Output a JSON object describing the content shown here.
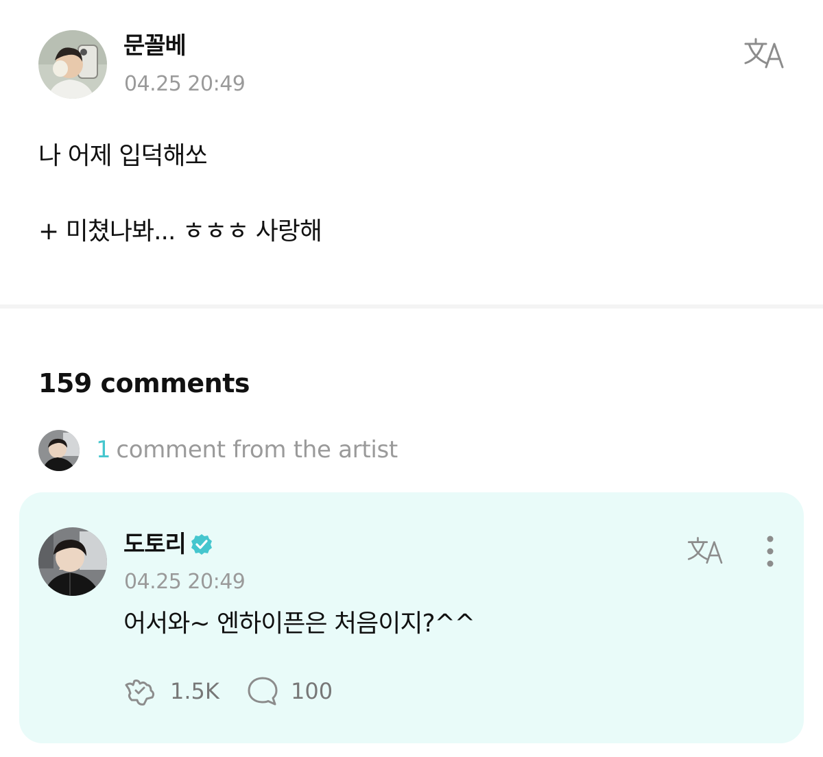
{
  "post": {
    "author": "문꼴베",
    "time": "04.25 20:49",
    "lines": [
      "나 어제 입덕해쏘",
      "+ 미쳤나봐... ㅎㅎㅎ 사랑해"
    ],
    "translate_icon": "translate-icon"
  },
  "comments": {
    "count_label": "159 comments",
    "artist_count": "1",
    "artist_label": "comment from the artist"
  },
  "artist_comment": {
    "author": "도토리",
    "verified_icon": "verified-badge-icon",
    "time": "04.25 20:49",
    "text": "어서와~ 엔하이픈은 처음이지?^^",
    "reactions": "1.5K",
    "replies": "100",
    "reaction_icon": "reaction-icon",
    "reply_icon": "comment-bubble-icon",
    "more_icon": "more-vertical-icon"
  },
  "colors": {
    "accent": "#45c6ce",
    "card_background": "#e9fbf9",
    "muted_text": "#9a9a9a",
    "divider": "#f4f4f4"
  }
}
